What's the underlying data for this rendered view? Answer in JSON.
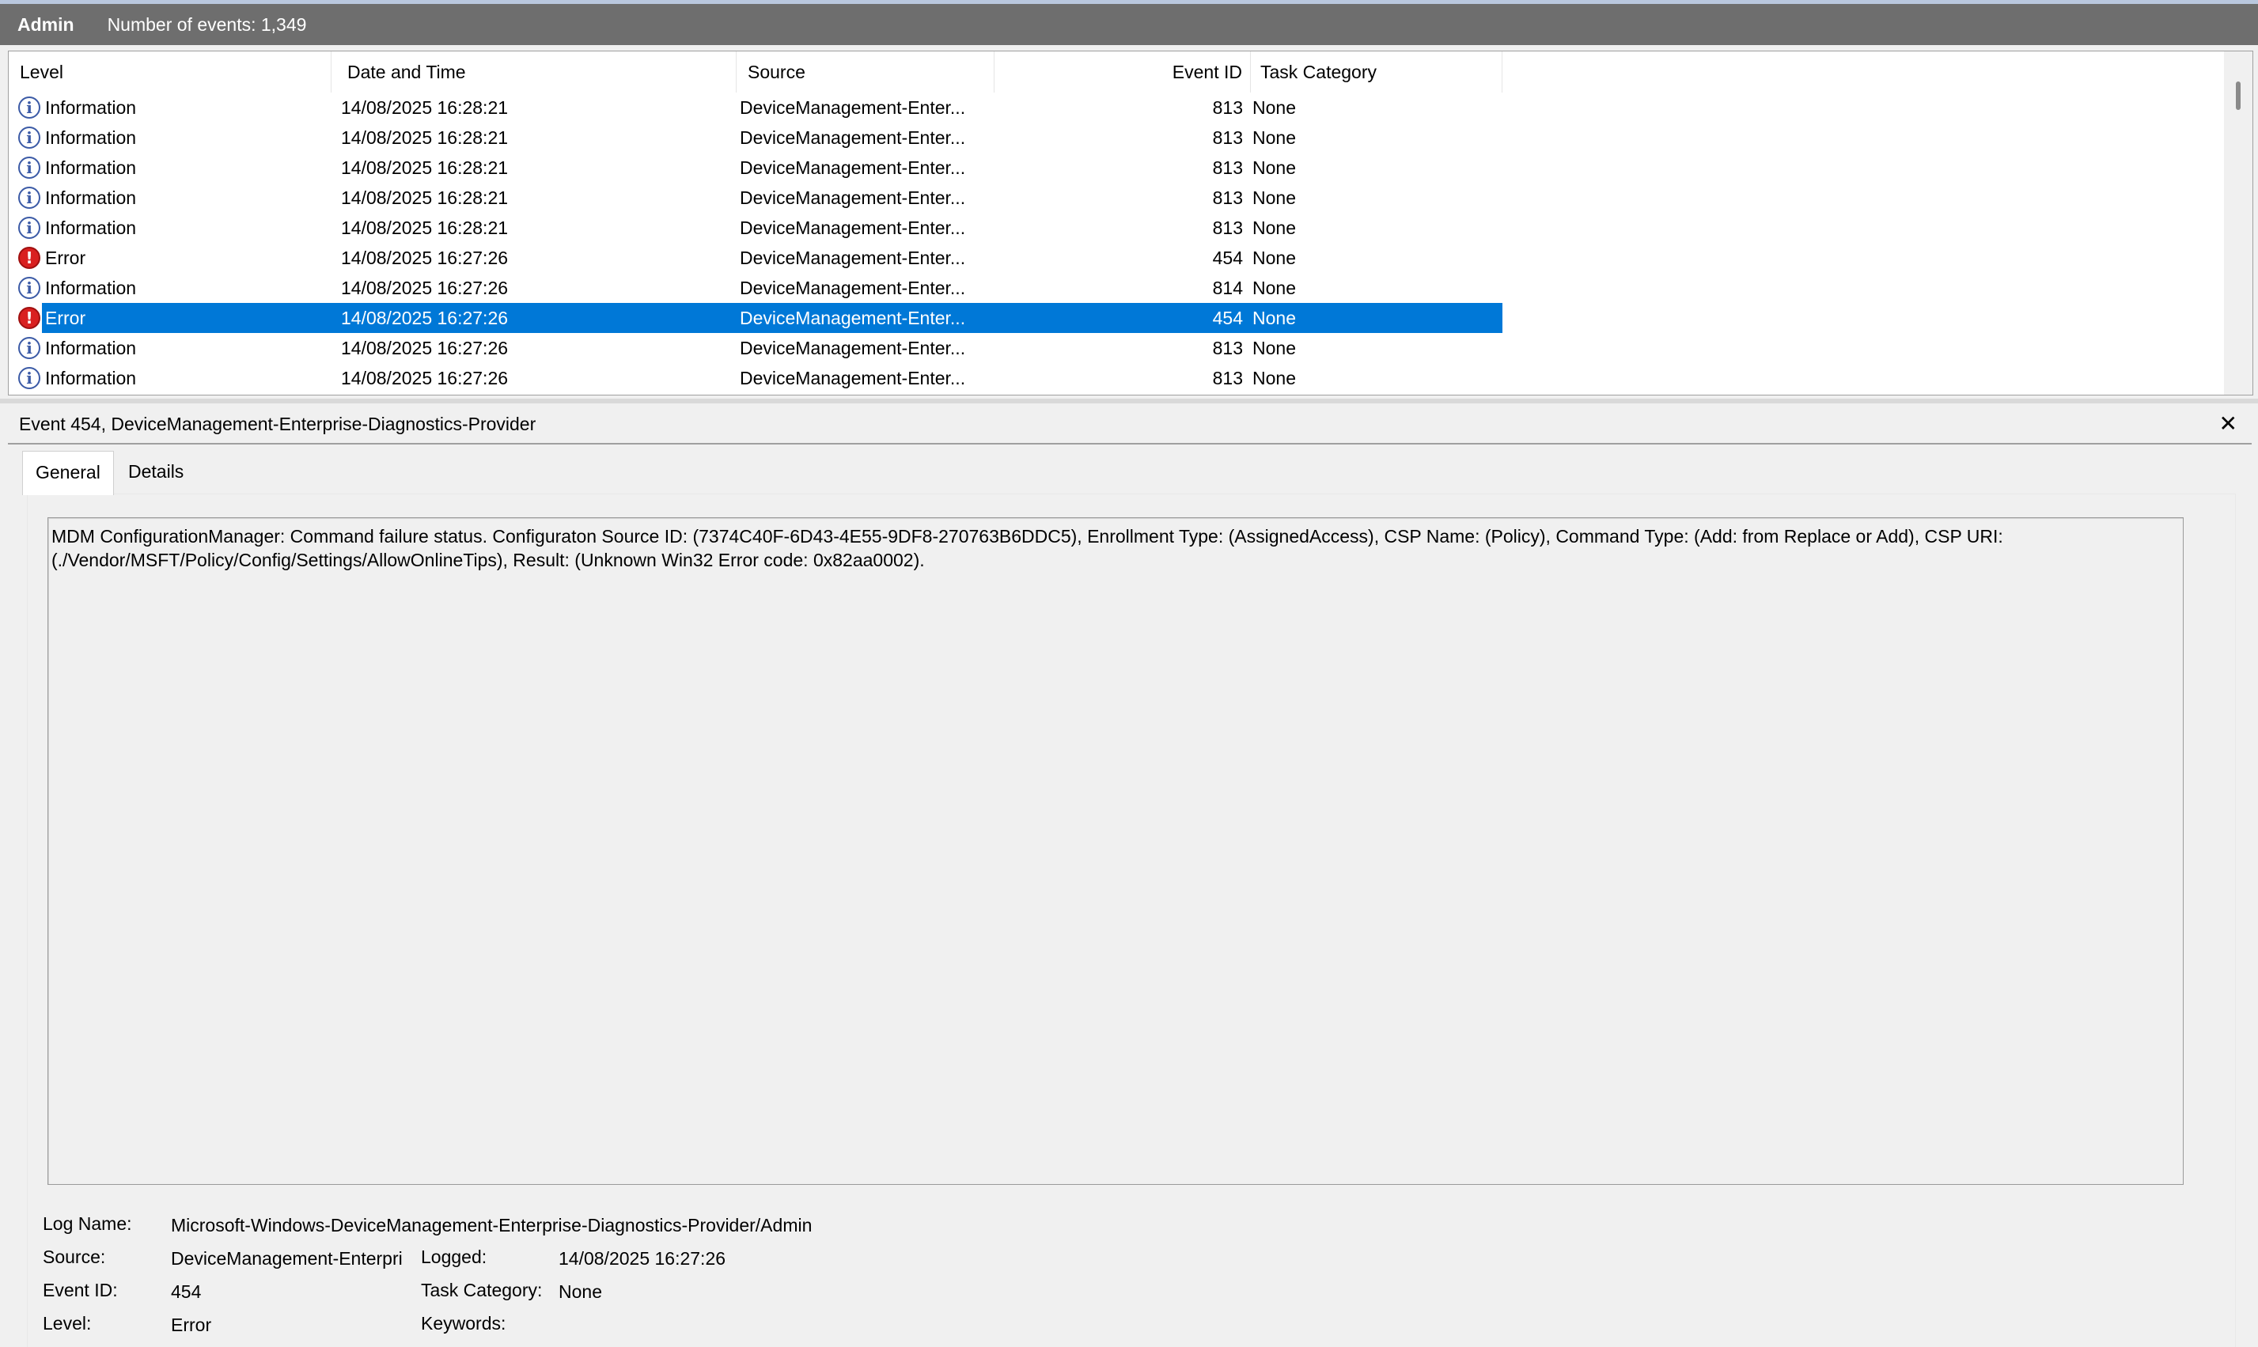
{
  "header": {
    "title": "Admin",
    "count_text": "Number of events: 1,349"
  },
  "columns": [
    "Level",
    "Date and Time",
    "Source",
    "Event ID",
    "Task Category"
  ],
  "events": [
    {
      "level": "Information",
      "icon": "information-icon",
      "datetime": "14/08/2025 16:28:21",
      "source": "DeviceManagement-Enter...",
      "event_id": "813",
      "task": "None",
      "selected": false
    },
    {
      "level": "Information",
      "icon": "information-icon",
      "datetime": "14/08/2025 16:28:21",
      "source": "DeviceManagement-Enter...",
      "event_id": "813",
      "task": "None",
      "selected": false
    },
    {
      "level": "Information",
      "icon": "information-icon",
      "datetime": "14/08/2025 16:28:21",
      "source": "DeviceManagement-Enter...",
      "event_id": "813",
      "task": "None",
      "selected": false
    },
    {
      "level": "Information",
      "icon": "information-icon",
      "datetime": "14/08/2025 16:28:21",
      "source": "DeviceManagement-Enter...",
      "event_id": "813",
      "task": "None",
      "selected": false
    },
    {
      "level": "Information",
      "icon": "information-icon",
      "datetime": "14/08/2025 16:28:21",
      "source": "DeviceManagement-Enter...",
      "event_id": "813",
      "task": "None",
      "selected": false
    },
    {
      "level": "Error",
      "icon": "error-icon",
      "datetime": "14/08/2025 16:27:26",
      "source": "DeviceManagement-Enter...",
      "event_id": "454",
      "task": "None",
      "selected": false
    },
    {
      "level": "Information",
      "icon": "information-icon",
      "datetime": "14/08/2025 16:27:26",
      "source": "DeviceManagement-Enter...",
      "event_id": "814",
      "task": "None",
      "selected": false
    },
    {
      "level": "Error",
      "icon": "error-icon",
      "datetime": "14/08/2025 16:27:26",
      "source": "DeviceManagement-Enter...",
      "event_id": "454",
      "task": "None",
      "selected": true
    },
    {
      "level": "Information",
      "icon": "information-icon",
      "datetime": "14/08/2025 16:27:26",
      "source": "DeviceManagement-Enter...",
      "event_id": "813",
      "task": "None",
      "selected": false
    },
    {
      "level": "Information",
      "icon": "information-icon",
      "datetime": "14/08/2025 16:27:26",
      "source": "DeviceManagement-Enter...",
      "event_id": "813",
      "task": "None",
      "selected": false
    }
  ],
  "detail": {
    "title": "Event 454, DeviceManagement-Enterprise-Diagnostics-Provider",
    "close_icon": "close-icon",
    "tabs": [
      "General",
      "Details"
    ],
    "message_line1": "MDM ConfigurationManager: Command failure status. Configuraton Source ID: (7374C40F-6D43-4E55-9DF8-270763B6DDC5), Enrollment Type: (AssignedAccess), CSP Name: (Policy), Command Type: (Add: from Replace or Add), CSP URI:",
    "message_line2": "(./Vendor/MSFT/Policy/Config/Settings/AllowOnlineTips), Result: (Unknown Win32 Error code: 0x82aa0002).",
    "props": {
      "log_name_label": "Log Name:",
      "log_name_value": "Microsoft-Windows-DeviceManagement-Enterprise-Diagnostics-Provider/Admin",
      "source_label": "Source:",
      "source_value": "DeviceManagement-Enterpri",
      "logged_label": "Logged:",
      "logged_value": "14/08/2025 16:27:26",
      "event_id_label": "Event ID:",
      "event_id_value": "454",
      "task_category_label": "Task Category:",
      "task_category_value": "None",
      "level_label": "Level:",
      "level_value": "Error",
      "keywords_label": "Keywords:"
    }
  },
  "colors": {
    "selection": "#0078d7",
    "header_bg": "#6e6e6e",
    "error_icon": "#d92020",
    "info_icon": "#3b5aa6"
  }
}
